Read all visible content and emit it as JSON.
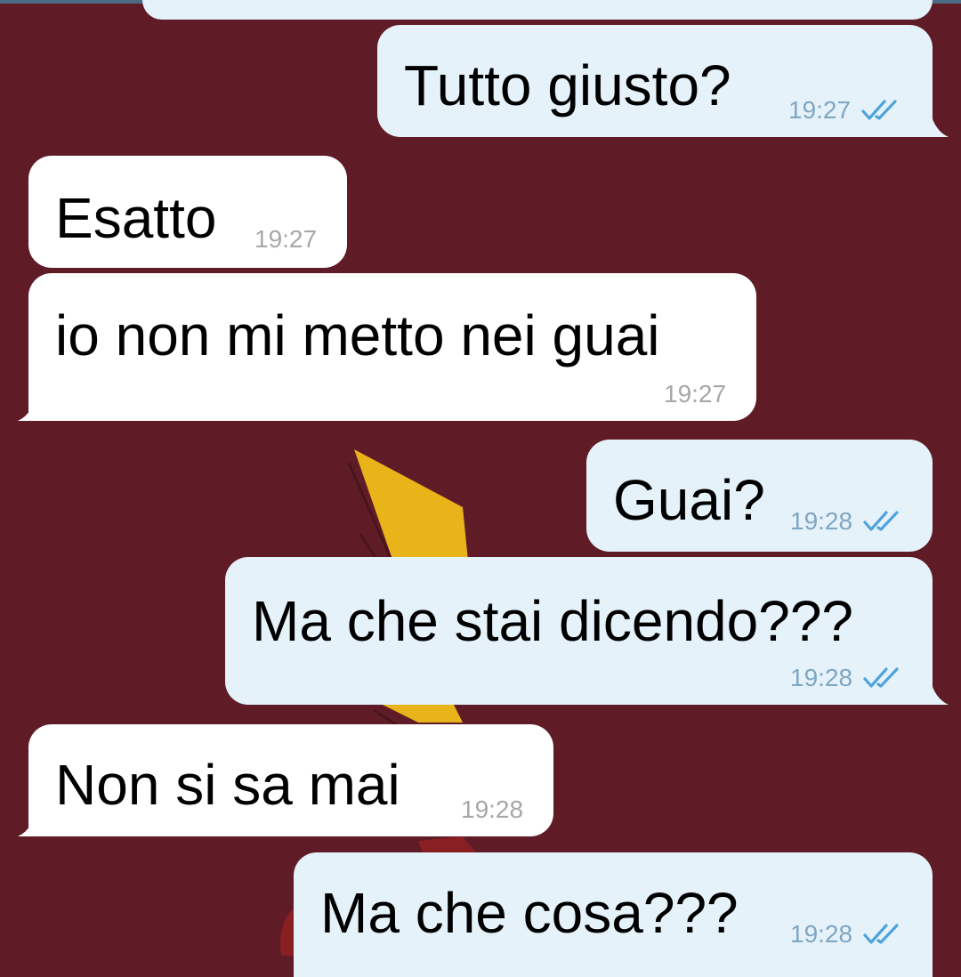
{
  "colors": {
    "background": "#5f1c27",
    "incoming_bubble": "#ffffff",
    "outgoing_bubble": "#e6f2fa",
    "incoming_time": "#a7a7a7",
    "outgoing_time": "#7fa6c2",
    "read_ticks": "#4fa3dc"
  },
  "messages": [
    {
      "direction": "outgoing",
      "text": "Tutto giusto?",
      "time": "19:27",
      "status_icon": "double-check-icon"
    },
    {
      "direction": "incoming",
      "text": "Esatto",
      "time": "19:27"
    },
    {
      "direction": "incoming",
      "text": "io non mi metto nei guai",
      "time": "19:27"
    },
    {
      "direction": "outgoing",
      "text": "Guai?",
      "time": "19:28",
      "status_icon": "double-check-icon"
    },
    {
      "direction": "outgoing",
      "text": "Ma che stai dicendo???",
      "time": "19:28",
      "status_icon": "double-check-icon"
    },
    {
      "direction": "incoming",
      "text": "Non si sa mai",
      "time": "19:28"
    },
    {
      "direction": "outgoing",
      "text": "Ma che cosa???",
      "time": "19:28",
      "status_icon": "double-check-icon"
    }
  ]
}
